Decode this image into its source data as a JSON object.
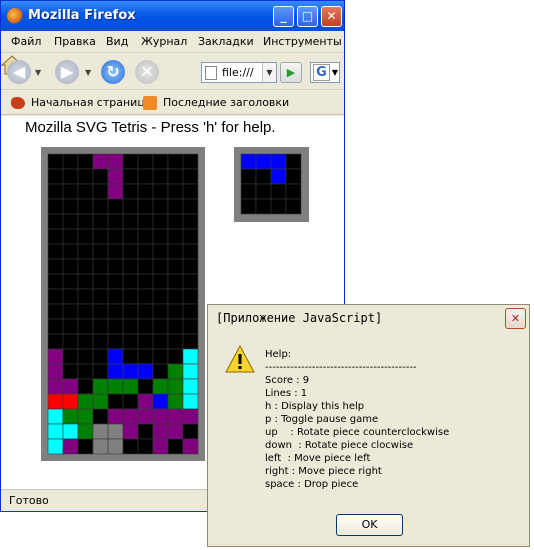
{
  "window": {
    "title": "Mozilla Firefox"
  },
  "menu": [
    "Файл",
    "Правка",
    "Вид",
    "Журнал",
    "Закладки",
    "Инструменты"
  ],
  "navbar": {
    "url": "file:///"
  },
  "bookmarks": [
    "Начальная страница",
    "Последние заголовки"
  ],
  "page": {
    "heading": "Mozilla SVG Tetris - Press 'h' for help."
  },
  "status": "Готово",
  "colors": {
    "empty": "#000000",
    "purple": "#800080",
    "blue": "#0000ff",
    "green": "#008000",
    "cyan": "#00ffff",
    "red": "#ff0000",
    "gray": "#808080",
    "dialog_bg": "#ece9d8",
    "titlebar": "#0054e3"
  },
  "board": {
    "cols": 10,
    "rows": 20,
    "grid": [
      "...PP.....",
      "....P.....",
      "....P.....",
      "..........",
      "..........",
      "..........",
      "..........",
      "..........",
      "..........",
      "..........",
      "..........",
      "..........",
      "..........",
      "P...B....C",
      "P...BBB.GC",
      "PP.GGG.GGC",
      "RRGG..PBGC",
      "CGG.PPPPPP",
      "CCGGGP.PP.",
      "CP.GG..P.P"
    ]
  },
  "preview": {
    "cols": 4,
    "rows": 4,
    "grid": [
      "BBB.",
      "..B.",
      "....",
      "...."
    ]
  },
  "dialog": {
    "title": "[Приложение JavaScript]",
    "lines": [
      "Help:",
      "------------------------------------------",
      "",
      "Score : 9",
      "Lines : 1",
      "h : Display this help",
      "p : Toggle pause game",
      "up    : Rotate piece counterclockwise",
      "down  : Rotate piece clocwise",
      "left  : Move piece left",
      "right : Move piece right",
      "space : Drop piece"
    ],
    "ok": "OK"
  }
}
